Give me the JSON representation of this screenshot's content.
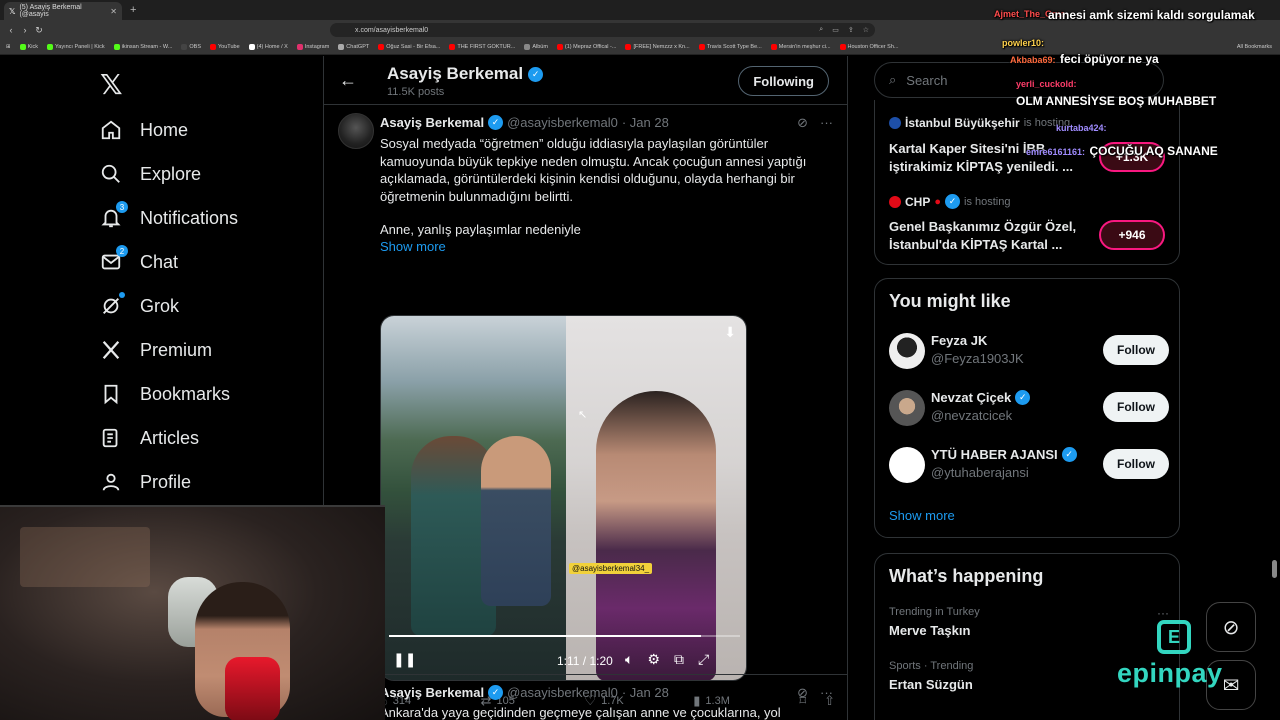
{
  "browser": {
    "tab_title": "(5) Asayiş Berkemal (@asayis",
    "url": "x.com/asayisberkemal0",
    "bookmarks": [
      {
        "label": "Kick",
        "color": "#53fc18"
      },
      {
        "label": "Yayıncı Paneli | Kick",
        "color": "#53fc18"
      },
      {
        "label": "ikinsan Stream - W...",
        "color": "#53fc18"
      },
      {
        "label": "OBS",
        "color": "#444444"
      },
      {
        "label": "YouTube",
        "color": "#ff0000"
      },
      {
        "label": "(4) Home / X",
        "color": "#ffffff"
      },
      {
        "label": "Instagram",
        "color": "#e1306c"
      },
      {
        "label": "ChatGPT",
        "color": "#aaaaaa"
      },
      {
        "label": "Oğuz Sasi - Bir Efsa...",
        "color": "#ff0000"
      },
      {
        "label": "THE FIRST GOKTUR...",
        "color": "#ff0000"
      },
      {
        "label": "Albüm",
        "color": "#888888"
      },
      {
        "label": "(1) Mepraz Offical -...",
        "color": "#ff0000"
      },
      {
        "label": "[FREE] Nemzzz x Kn...",
        "color": "#ff0000"
      },
      {
        "label": "Travis Scott Type Be...",
        "color": "#ff0000"
      },
      {
        "label": "Mersin'in meşhur ci...",
        "color": "#ff0000"
      },
      {
        "label": "Houston Officer Sh...",
        "color": "#ff0000"
      }
    ],
    "all_bookmarks": "All Bookmarks"
  },
  "nav": {
    "items": [
      {
        "label": "Home",
        "icon": "home-icon"
      },
      {
        "label": "Explore",
        "icon": "search-icon"
      },
      {
        "label": "Notifications",
        "icon": "bell-icon",
        "badge": "3"
      },
      {
        "label": "Chat",
        "icon": "mail-icon",
        "badge": "2"
      },
      {
        "label": "Grok",
        "icon": "grok-icon"
      },
      {
        "label": "Premium",
        "icon": "x-icon"
      },
      {
        "label": "Bookmarks",
        "icon": "bookmark-icon"
      },
      {
        "label": "Articles",
        "icon": "article-icon"
      },
      {
        "label": "Profile",
        "icon": "person-icon"
      }
    ]
  },
  "profile_header": {
    "name": "Asayiş Berkemal",
    "posts": "11.5K posts",
    "following_label": "Following"
  },
  "tweet1": {
    "name": "Asayiş Berkemal",
    "handle": "@asayisberkemal0",
    "date": "· Jan 28",
    "text": "Sosyal medyada “öğretmen” olduğu iddiasıyla paylaşılan görüntüler kamuoyunda büyük tepkiye neden olmuştu. Ancak çocuğun annesi yaptığı açıklamada, görüntülerdeki kişinin kendisi olduğunu, olayda herhangi bir öğretmenin bulunmadığını belirtti.",
    "text2": "Anne, yanlış paylaşımlar nedeniyle",
    "show_more": "Show more",
    "video": {
      "handle_tag": "@asayisberkemal34_",
      "time": "1:11 / 1:20",
      "progress": 0.8875
    },
    "metrics": {
      "replies": "314",
      "reposts": "105",
      "likes": "1.7K",
      "views": "1.3M"
    }
  },
  "tweet2": {
    "name": "Asayiş Berkemal",
    "handle": "@asayisberkemal0",
    "date": "· Jan 28",
    "text": "Ankara'da yaya geçidinden geçmeye çalışan anne ve çocuklarına, yol"
  },
  "right": {
    "search_placeholder": "Search",
    "live": [
      {
        "name": "İstanbul Büyükşehir",
        "status": "is hosting",
        "title": "Kartal Kaper Sitesi'ni İBB iştirakimiz KİPTAŞ yeniledi. ...",
        "count": "+1.3K"
      },
      {
        "name": "CHP",
        "status": "is hosting",
        "title": "Genel Başkanımız Özgür Özel, İstanbul'da KİPTAŞ Kartal ...",
        "count": "+946"
      }
    ],
    "you_might_like": {
      "title": "You might like",
      "users": [
        {
          "name": "Feyza JK",
          "handle": "@Feyza1903JK",
          "verified": false
        },
        {
          "name": "Nevzat Çiçek",
          "handle": "@nevzatcicek",
          "verified": true
        },
        {
          "name": "YTÜ HABER AJANSI",
          "handle": "@ytuhaberajansi",
          "verified": true
        }
      ],
      "follow_label": "Follow",
      "show_more": "Show more"
    },
    "whats_happening": {
      "title": "What’s happening",
      "trends": [
        {
          "meta": "Trending in Turkey",
          "name": "Merve Taşkın"
        },
        {
          "meta": "Sports · Trending",
          "name": "Ertan Süzgün"
        }
      ]
    }
  },
  "chat": [
    {
      "user": "Ajmet_The_Grea",
      "msg": "",
      "color": "#ff4d4d"
    },
    {
      "user": "",
      "msg": "annesi amk sizemi kaldı sorgulamak",
      "color": "#ffffff"
    },
    {
      "user": "powler10:",
      "msg": "",
      "color": "#ffd24d"
    },
    {
      "user": "Akbaba69:",
      "msg": "feci öpüyor ne ya",
      "color": "#ff6a3d"
    },
    {
      "user": "yerli_cuckold:",
      "msg": "OLM ANNESİYSE BOŞ MUHABBET",
      "color": "#ff3d6a"
    },
    {
      "user": "kurtaba424:",
      "msg": "",
      "color": "#a08cff"
    },
    {
      "user": "emre6161161:",
      "msg": "ÇOCUĞU AQ SANANE",
      "color": "#a08cff"
    }
  ],
  "sponsor": {
    "text": "epinpay"
  }
}
